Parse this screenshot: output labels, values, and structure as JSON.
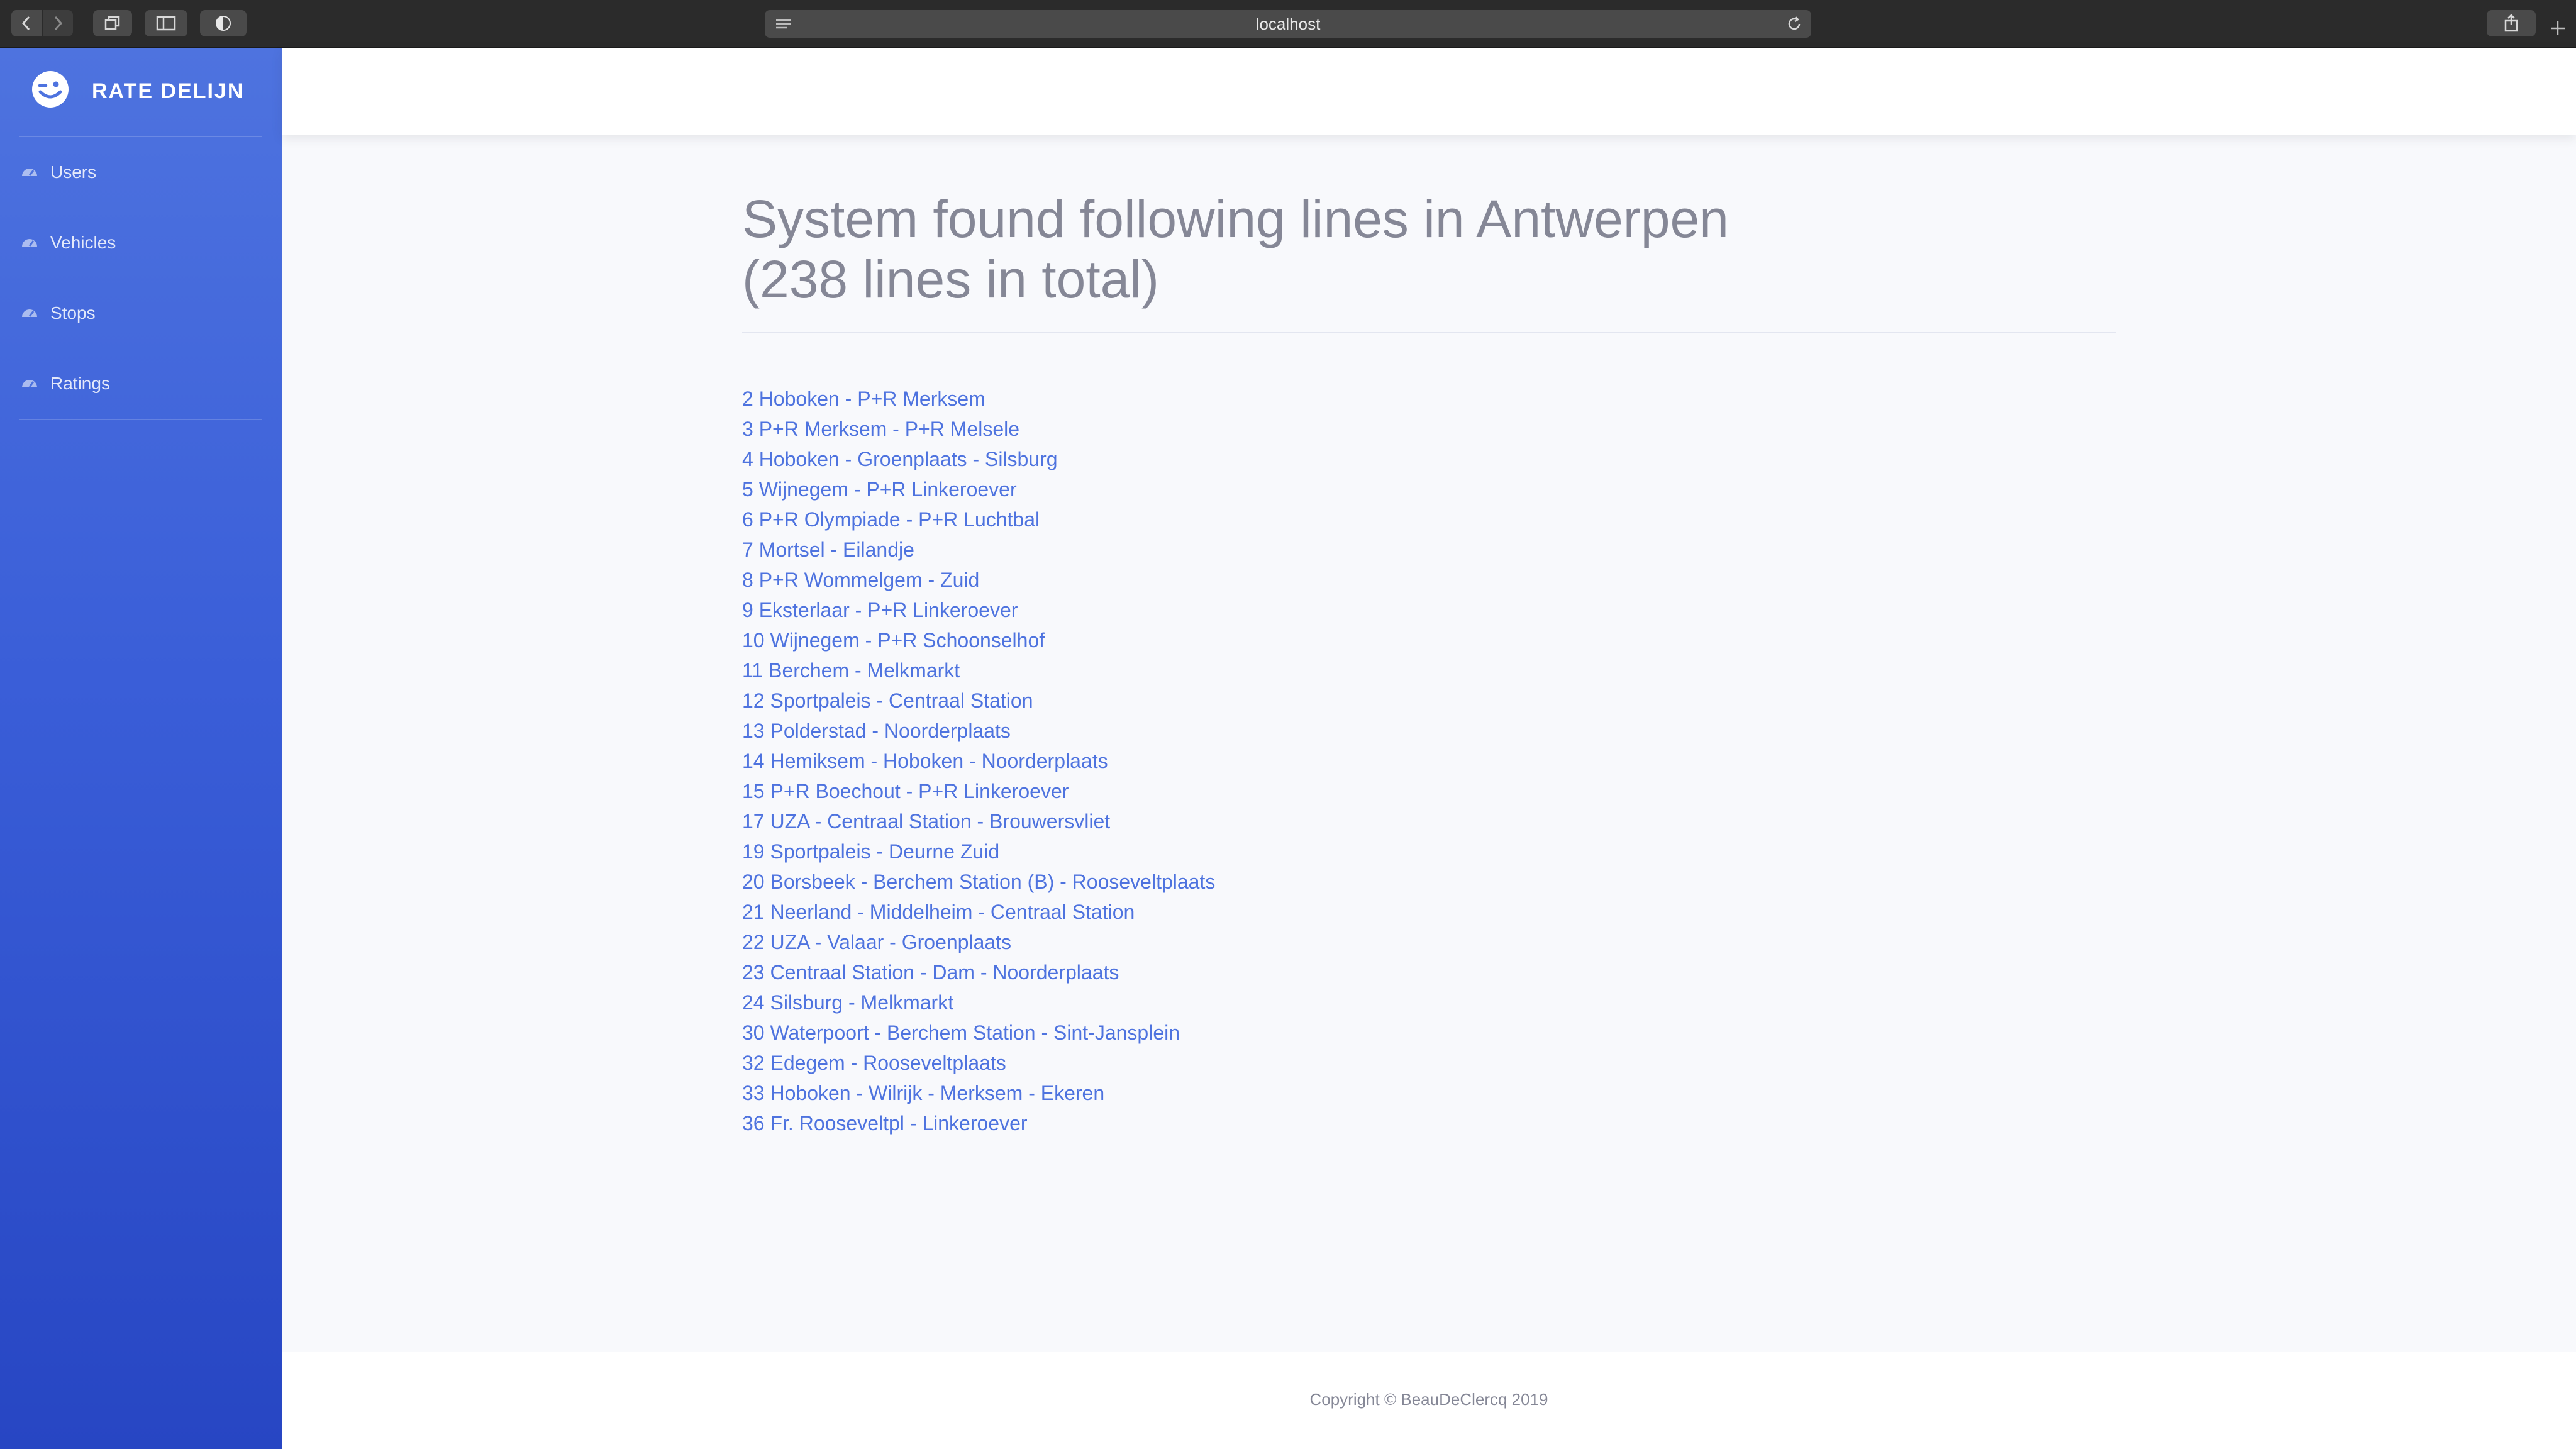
{
  "browser": {
    "url": "localhost"
  },
  "sidebar": {
    "brand": "RATE DELIJN",
    "items": [
      {
        "label": "Users"
      },
      {
        "label": "Vehicles"
      },
      {
        "label": "Stops"
      },
      {
        "label": "Ratings"
      }
    ]
  },
  "main": {
    "title_line1": "System found following lines in Antwerpen",
    "title_line2": "(238 lines in total)",
    "lines": [
      "2 Hoboken - P+R Merksem",
      "3 P+R Merksem - P+R Melsele",
      "4 Hoboken - Groenplaats - Silsburg",
      "5 Wijnegem - P+R Linkeroever",
      "6 P+R Olympiade - P+R Luchtbal",
      "7 Mortsel - Eilandje",
      "8 P+R Wommelgem - Zuid",
      "9 Eksterlaar - P+R Linkeroever",
      "10 Wijnegem - P+R Schoonselhof",
      "11 Berchem - Melkmarkt",
      "12 Sportpaleis - Centraal Station",
      "13 Polderstad - Noorderplaats",
      "14 Hemiksem - Hoboken - Noorderplaats",
      "15 P+R Boechout - P+R Linkeroever",
      "17 UZA - Centraal Station - Brouwersvliet",
      "19 Sportpaleis - Deurne Zuid",
      "20 Borsbeek - Berchem Station (B) - Rooseveltplaats",
      "21 Neerland - Middelheim - Centraal Station",
      "22 UZA - Valaar - Groenplaats",
      "23 Centraal Station - Dam - Noorderplaats",
      "24 Silsburg - Melkmarkt",
      "30 Waterpoort - Berchem Station - Sint-Jansplein",
      "32 Edegem - Rooseveltplaats",
      "33 Hoboken - Wilrijk - Merksem - Ekeren",
      "36 Fr. Rooseveltpl - Linkeroever"
    ]
  },
  "footer": {
    "copyright": "Copyright © BeauDeClercq 2019"
  },
  "colors": {
    "primary": "#4e73df",
    "sidebar_dark": "#2746c3",
    "muted_text": "#858796",
    "page_bg": "#f8f9fc"
  },
  "icons": [
    "back-arrow-icon",
    "forward-arrow-icon",
    "tabs-icon",
    "sidebar-toggle-icon",
    "shield-icon",
    "reader-icon",
    "reload-icon",
    "share-icon",
    "new-tab-icon",
    "winking-face-logo",
    "tachometer-icon"
  ]
}
